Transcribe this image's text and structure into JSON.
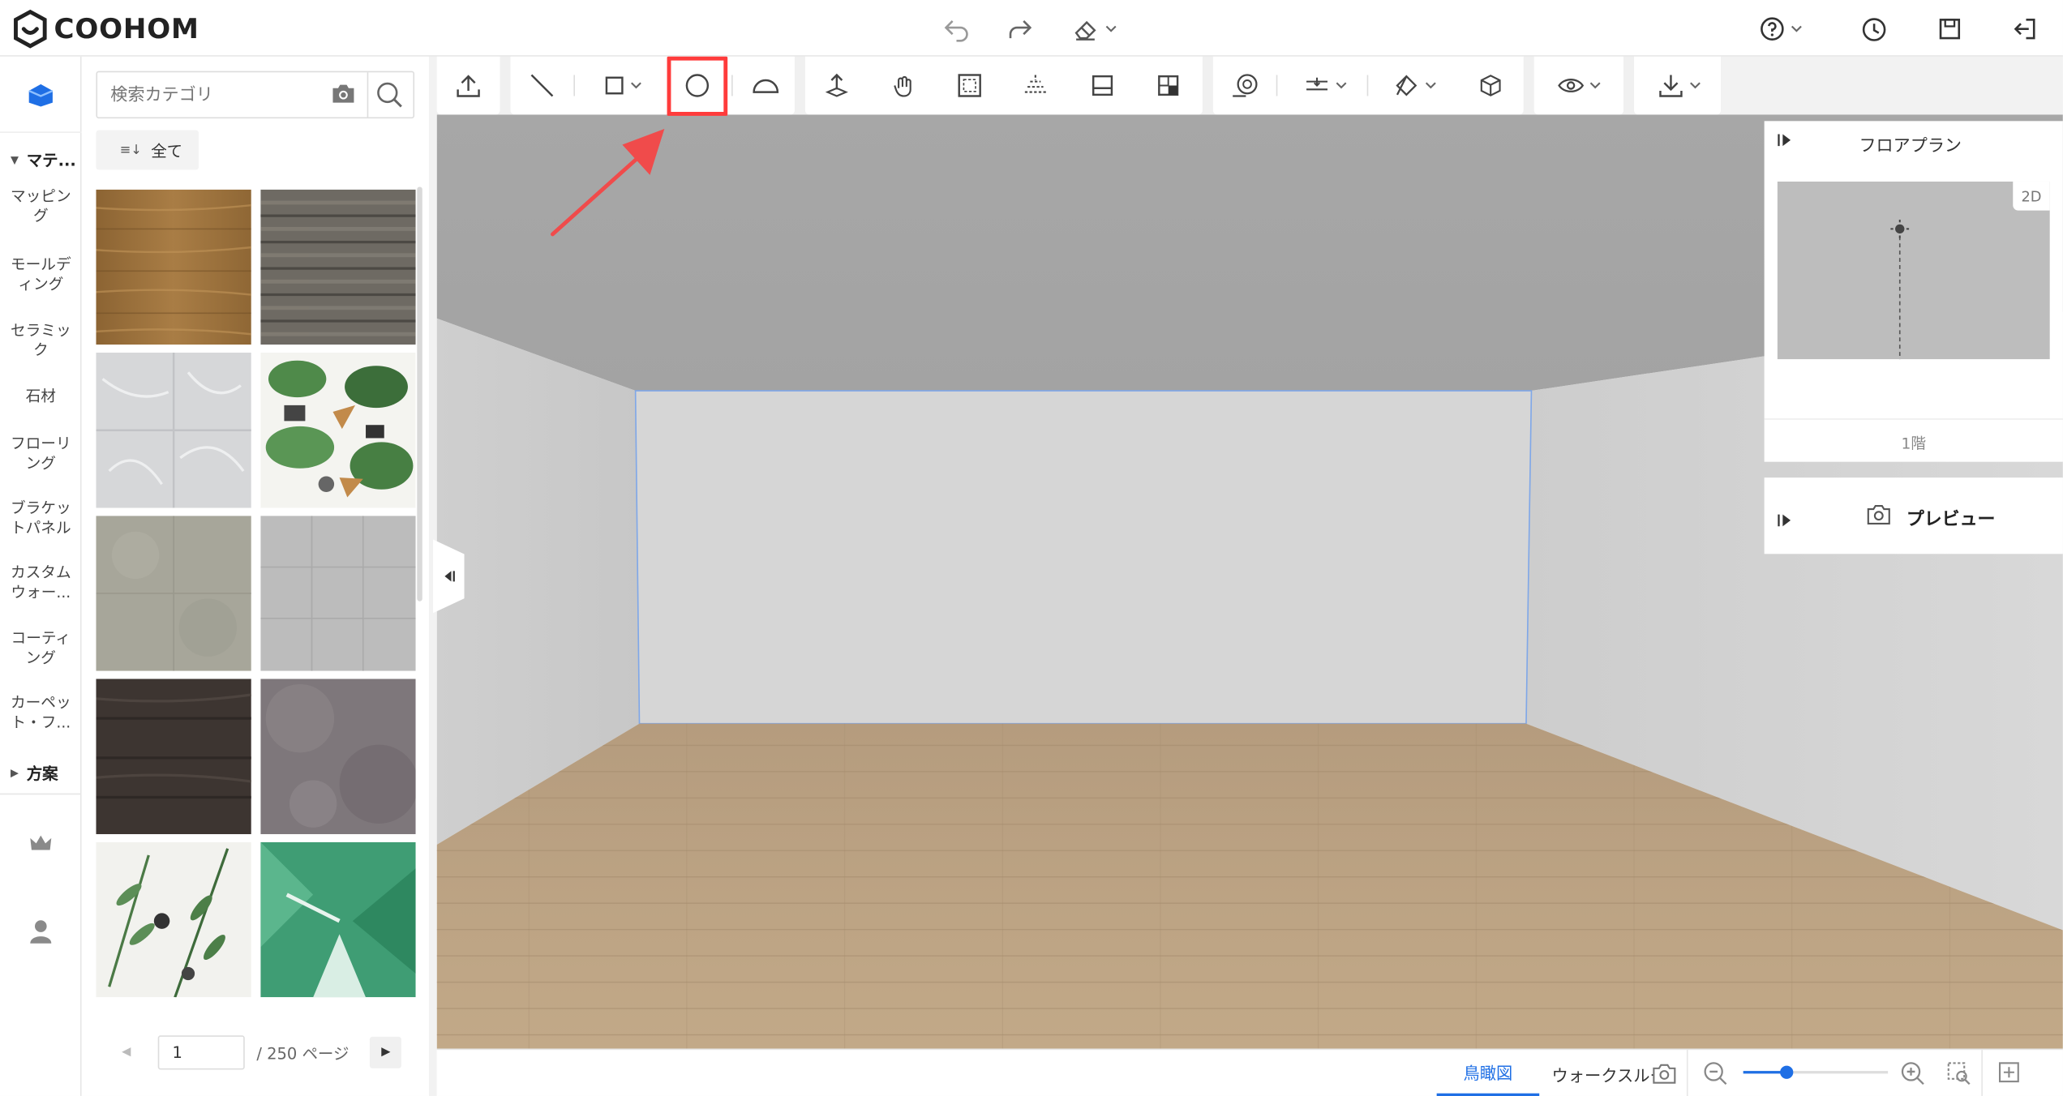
{
  "app": {
    "brand": "COOHOM"
  },
  "panel": {
    "search_placeholder": "検索カテゴリ",
    "all_label": "全て",
    "pager": {
      "current": "1",
      "total_label": "/ 250 ページ"
    }
  },
  "rail": {
    "sections": [
      {
        "label": "マテ..."
      },
      {
        "label": "方案"
      }
    ],
    "items": [
      {
        "label": "マッピング"
      },
      {
        "label": "モールディング"
      },
      {
        "label": "セラミック"
      },
      {
        "label": "石材"
      },
      {
        "label": "フローリング"
      },
      {
        "label": "ブラケットパネル"
      },
      {
        "label": "カスタムウォー..."
      },
      {
        "label": "コーティング"
      },
      {
        "label": "カーペット・フ..."
      }
    ]
  },
  "floorplan": {
    "title": "フロアプラン",
    "mode": "2D",
    "floor": "1階"
  },
  "preview": {
    "title": "プレビュー"
  },
  "bottom": {
    "tabs": [
      "鳥瞰図",
      "ウォークスルー"
    ]
  },
  "zoom": {
    "level": 0.3
  },
  "colors": {
    "accent": "#1f6fe5",
    "highlight": "#ff3b3b",
    "annotation_arrow": "#f04b4b"
  },
  "toolbar": {
    "icons": [
      "upload-icon",
      "line-tool-icon",
      "rectangle-tool-icon",
      "circle-tool-icon",
      "arc-tool-icon",
      "move-up-icon",
      "hand-icon",
      "frame-icon",
      "align-icon",
      "panel-icon",
      "layout-icon",
      "brush-icon",
      "level-icon",
      "paint-icon",
      "cube-icon",
      "eye-icon",
      "download-icon"
    ]
  }
}
